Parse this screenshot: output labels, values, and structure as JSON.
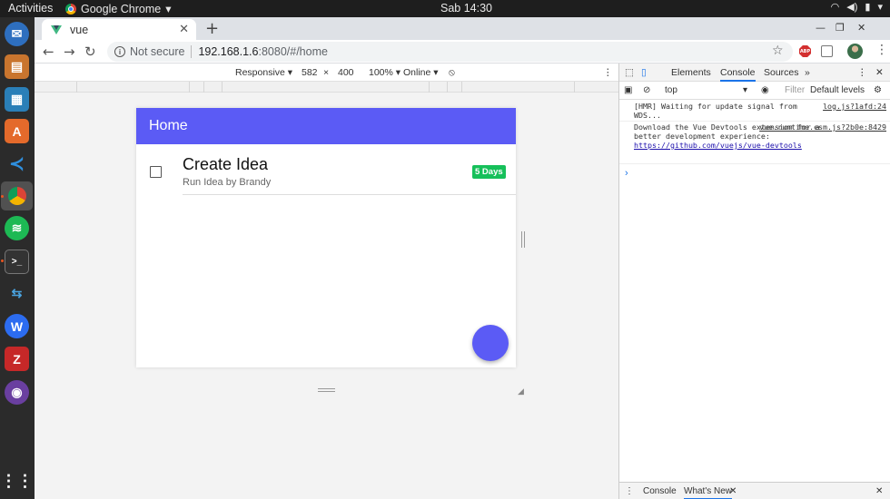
{
  "topbar": {
    "activities": "Activities",
    "app_name": "Google Chrome",
    "clock": "Sab 14:30"
  },
  "dock": {
    "items": [
      "files-icon",
      "firefox-icon",
      "writer-icon",
      "software-center-icon",
      "vscode-icon",
      "chrome-icon",
      "spotify-icon",
      "terminal-icon",
      "network-icon",
      "wps-icon",
      "filezilla-icon",
      "github-icon",
      "app-grid-icon"
    ]
  },
  "browser": {
    "tab_title": "vue",
    "not_secure": "Not secure",
    "url_host": "192.168.1.6",
    "url_path": ":8080/#/home",
    "abp_label": "ABP"
  },
  "device_toolbar": {
    "mode": "Responsive",
    "width": "582",
    "times": "×",
    "height": "400",
    "zoom": "100%",
    "network": "Online"
  },
  "app": {
    "header_title": "Home",
    "todos": [
      {
        "title": "Create Idea",
        "subtitle": "Run Idea by Brandy",
        "badge": "5 Days",
        "checked": false
      }
    ],
    "colors": {
      "primary": "#5b5bf5",
      "badge": "#16c05a"
    }
  },
  "devtools": {
    "tabs": [
      "Elements",
      "Console",
      "Sources"
    ],
    "active_tab": "Console",
    "more": "»",
    "context": "top",
    "filter_placeholder": "Filter",
    "levels": "Default levels",
    "messages": [
      {
        "text": "[HMR] Waiting for update signal from WDS...",
        "source": "log.js?1afd:24"
      },
      {
        "text": "Download the Vue Devtools extension for a better development experience:",
        "source": "vue.runtime.esm.js?2b0e:8429",
        "link": "https://github.com/vuejs/vue-devtools"
      }
    ],
    "drawer_tabs": [
      "Console",
      "What's New"
    ]
  }
}
